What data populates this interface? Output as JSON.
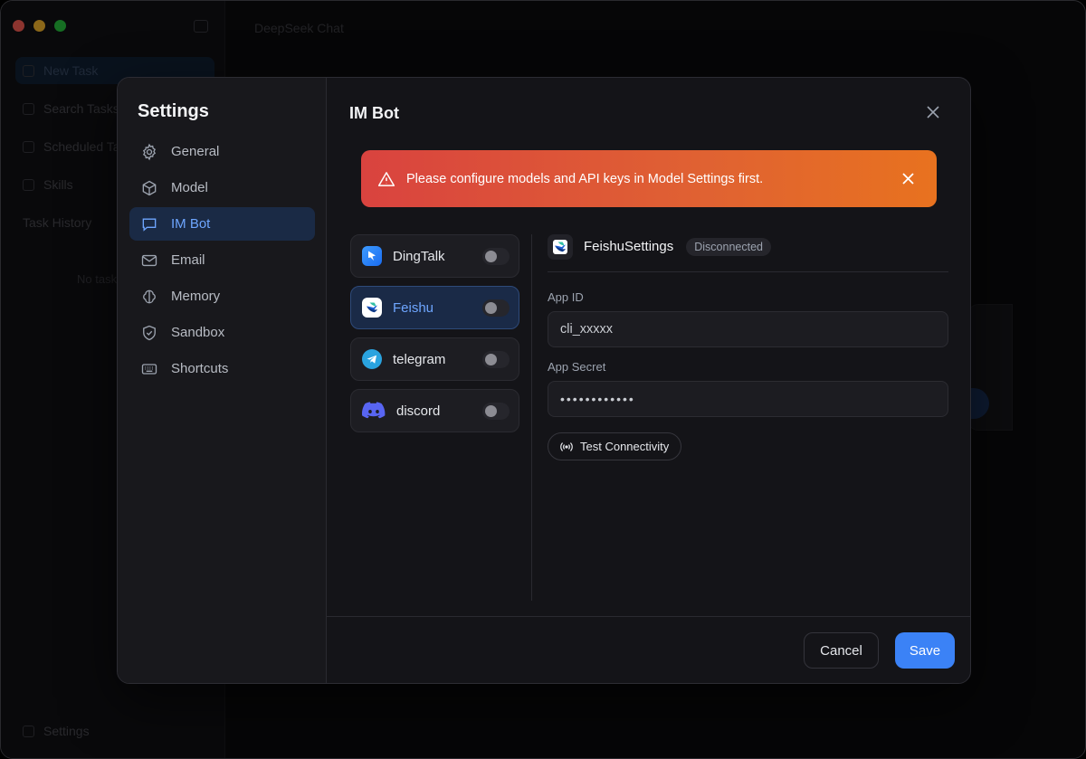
{
  "background_app": {
    "header_title": "DeepSeek Chat",
    "sidebar_items": [
      "New Task",
      "Search Tasks",
      "Scheduled Tasks",
      "Skills"
    ],
    "section": "Task History",
    "empty_hint": "No tasks",
    "footer_settings": "Settings"
  },
  "settings": {
    "title": "Settings",
    "nav": [
      {
        "label": "General",
        "icon": "gear-icon"
      },
      {
        "label": "Model",
        "icon": "cube-icon"
      },
      {
        "label": "IM Bot",
        "icon": "chat-bubble-icon",
        "active": true
      },
      {
        "label": "Email",
        "icon": "mail-icon"
      },
      {
        "label": "Memory",
        "icon": "brain-icon"
      },
      {
        "label": "Sandbox",
        "icon": "shield-icon"
      },
      {
        "label": "Shortcuts",
        "icon": "keyboard-icon"
      }
    ]
  },
  "content": {
    "title": "IM Bot",
    "alert": "Please configure models and API keys in Model Settings first.",
    "platforms": [
      {
        "label": "DingTalk",
        "enabled": false
      },
      {
        "label": "Feishu",
        "enabled": false,
        "selected": true
      },
      {
        "label": "telegram",
        "enabled": false
      },
      {
        "label": "discord",
        "enabled": false
      }
    ],
    "detail": {
      "name": "FeishuSettings",
      "status": "Disconnected",
      "app_id_label": "App ID",
      "app_id_value": "cli_xxxxx",
      "app_secret_label": "App Secret",
      "app_secret_value": "••••••••••••",
      "test_button": "Test Connectivity"
    },
    "cancel": "Cancel",
    "save": "Save"
  },
  "colors": {
    "accent": "#3b82f6",
    "alert_start": "#d9433f",
    "alert_end": "#e8721f"
  }
}
